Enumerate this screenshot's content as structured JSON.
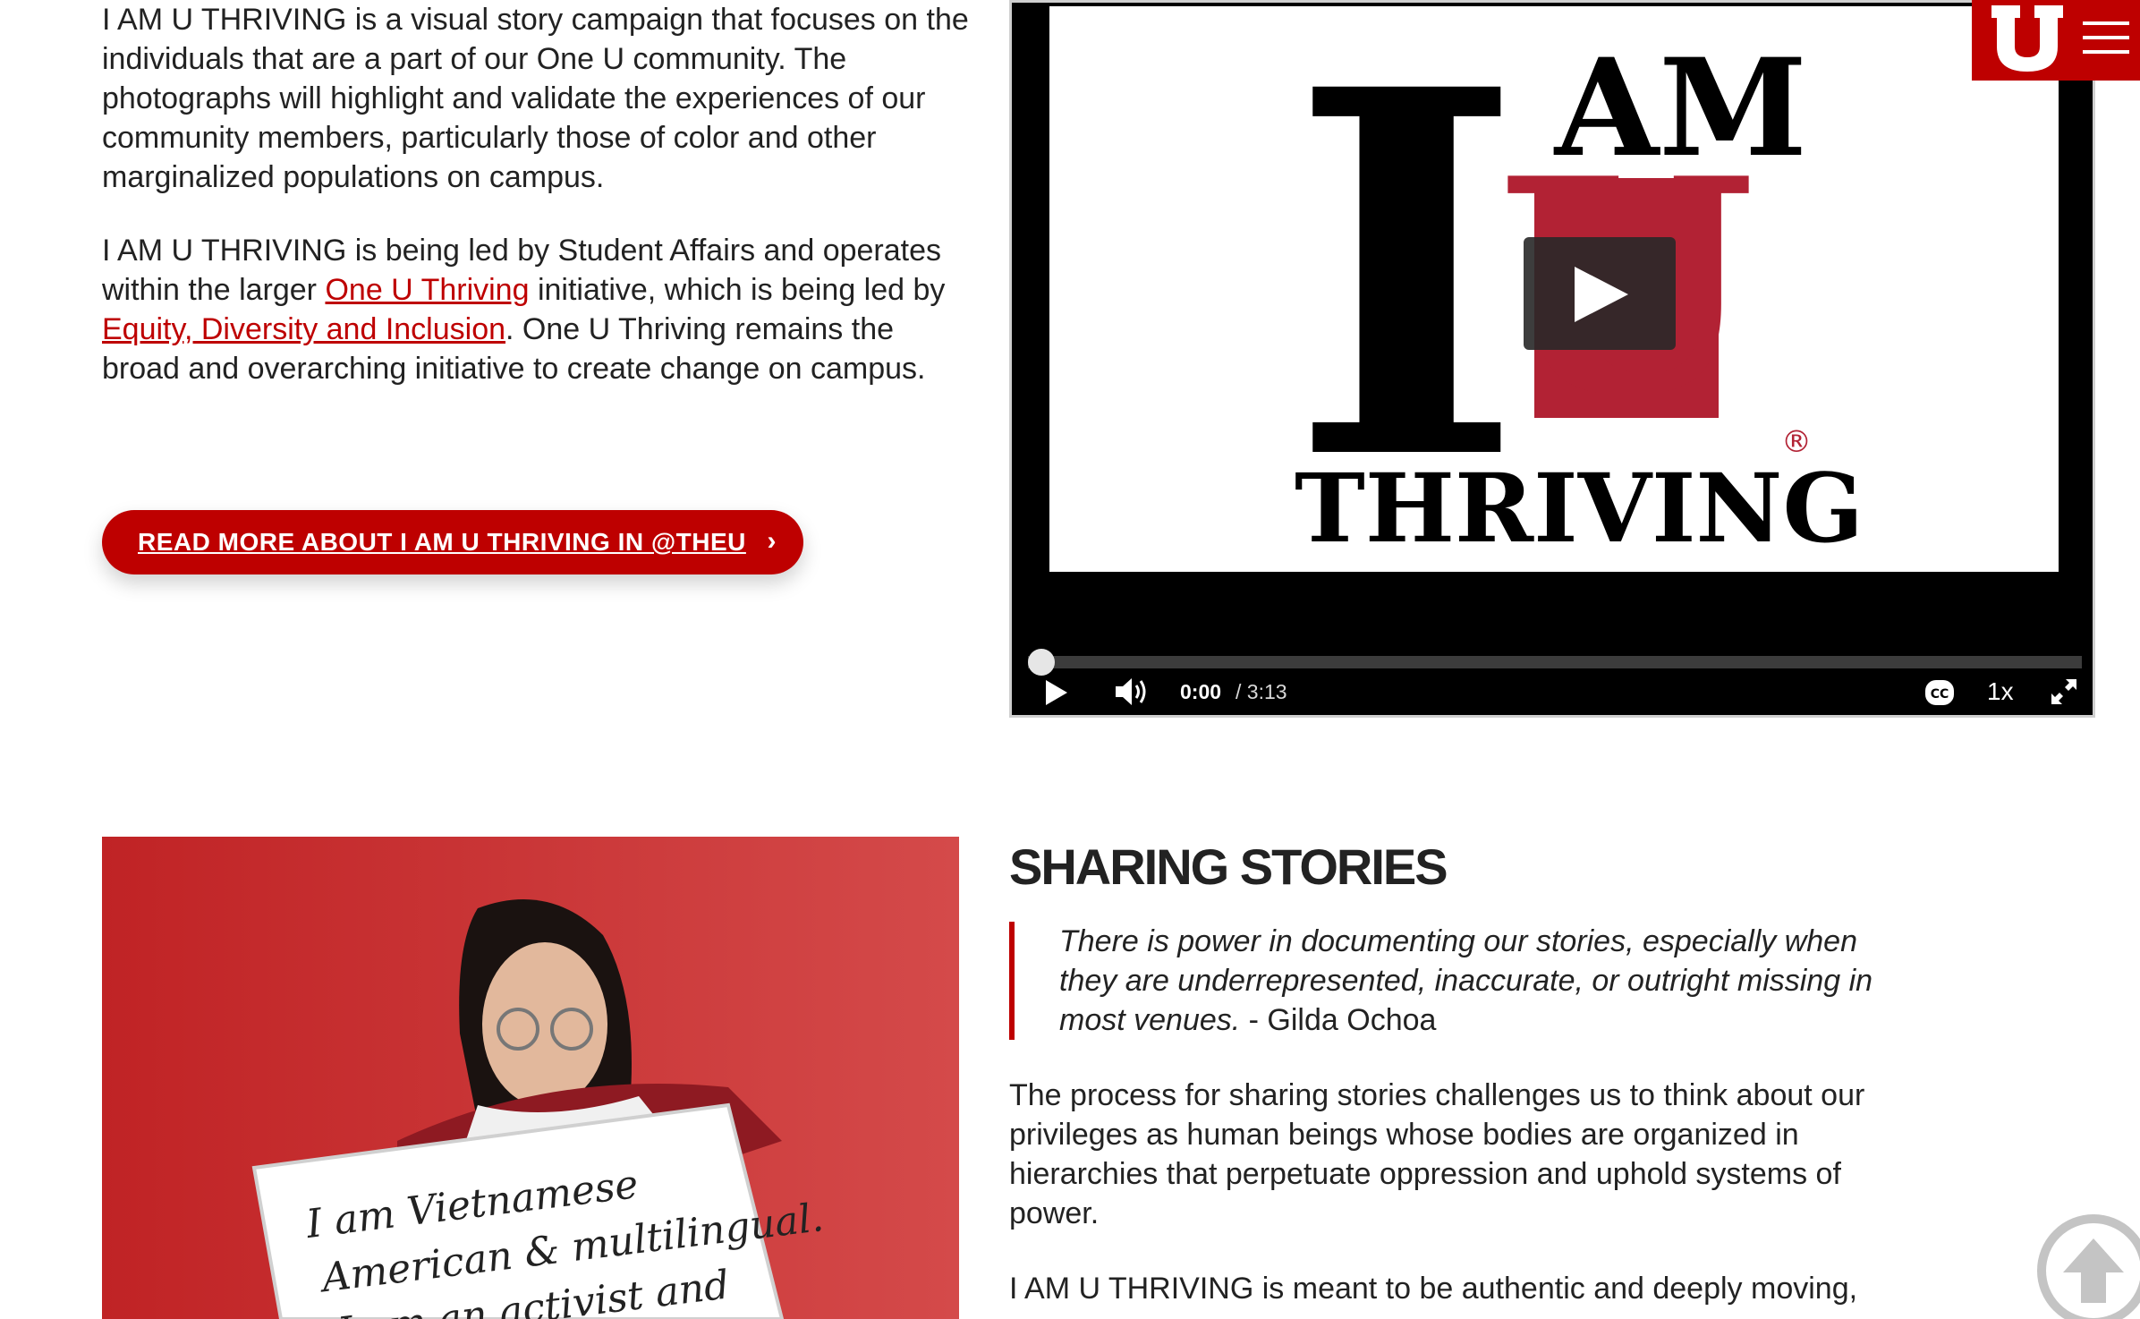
{
  "intro": {
    "p1": "I AM U THRIVING is a visual story campaign that focuses on the individuals that are a part of our One U community. The photographs will highlight and validate the experiences of our community members, particularly those of color and other marginalized populations on campus.",
    "p2_a": "I AM U THRIVING is being led by Student Affairs and operates within the larger ",
    "p2_link1": "One U Thriving",
    "p2_b": " initiative, which is being led by ",
    "p2_link2": "Equity, Diversity and Inclusion",
    "p2_c": ". One U Thriving remains the broad and overarching initiative to create change on campus."
  },
  "cta": {
    "label": "READ MORE ABOUT I AM U THRIVING IN @THEU",
    "chevron": "›"
  },
  "video": {
    "poster_text_i": "I",
    "poster_text_am": "AM",
    "poster_text_u": "U",
    "poster_text_thriving": "THRIVING",
    "poster_registered": "®",
    "current_time": "0:00",
    "total_time": "/ 3:13",
    "playback_rate": "1x",
    "progress": 0
  },
  "photo": {
    "sign_line1": "I am Vietnamese",
    "sign_line2": "American & multilingual.",
    "sign_line3": "I am an activist and"
  },
  "sharing": {
    "title": "SHARING STORIES",
    "quote": "There is power in documenting our stories, especially when they are underrepresented, inaccurate, or outright missing in most venues.",
    "quote_author": " - Gilda Ochoa",
    "p1": "The process for sharing stories challenges us to think about our privileges as human beings whose bodies are organized in hierarchies that perpetuate oppression and uphold systems of power.",
    "p2": "I AM U THRIVING is meant to be authentic and deeply moving, so"
  },
  "colors": {
    "accent": "#be0000",
    "poster_red": "#b22234",
    "text": "#222222"
  }
}
